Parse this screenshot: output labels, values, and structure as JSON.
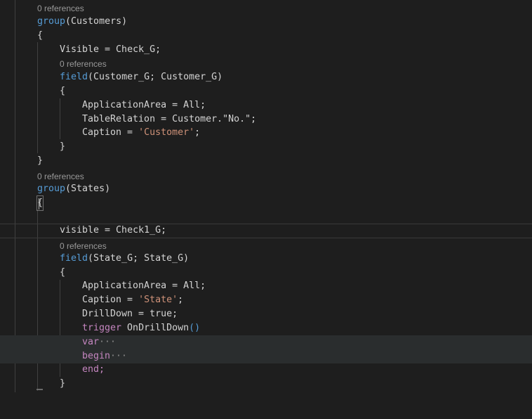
{
  "editor": {
    "codelens": {
      "customers_group": "0 references",
      "customer_field": "0 references",
      "states_group": "0 references",
      "state_field": "0 references"
    },
    "lines": {
      "group_customers_kw": "group",
      "group_customers_rest": "(Customers)",
      "brace_open_1": "{",
      "visible_1": "Visible = Check_G;",
      "field_customer_kw": "field",
      "field_customer_rest": "(Customer_G; Customer_G)",
      "brace_open_2": "{",
      "appArea_1": "ApplicationArea = All;",
      "tableRel_pre": "TableRelation = Customer.",
      "tableRel_str": "\"No.\"",
      "tableRel_end": ";",
      "caption_1_pre": "Caption = ",
      "caption_1_str": "'Customer'",
      "caption_1_end": ";",
      "brace_close_2": "}",
      "brace_close_1": "}",
      "group_states_kw": "group",
      "group_states_rest": "(States)",
      "brace_open_3": "{",
      "visible_2": "visible = Check1_G;",
      "field_state_kw": "field",
      "field_state_rest": "(State_G; State_G)",
      "brace_open_4": "{",
      "appArea_2": "ApplicationArea = All;",
      "caption_2_pre": "Caption = ",
      "caption_2_str": "'State'",
      "caption_2_end": ";",
      "drilldown": "DrillDown = true;",
      "trigger_kw": "trigger",
      "trigger_name": " OnDrillDown",
      "trigger_parens": "()",
      "var_kw": "var",
      "var_fold": "···",
      "begin_kw": "begin",
      "begin_fold": "···",
      "end_kw": "end;",
      "brace_close_4": "}"
    }
  }
}
